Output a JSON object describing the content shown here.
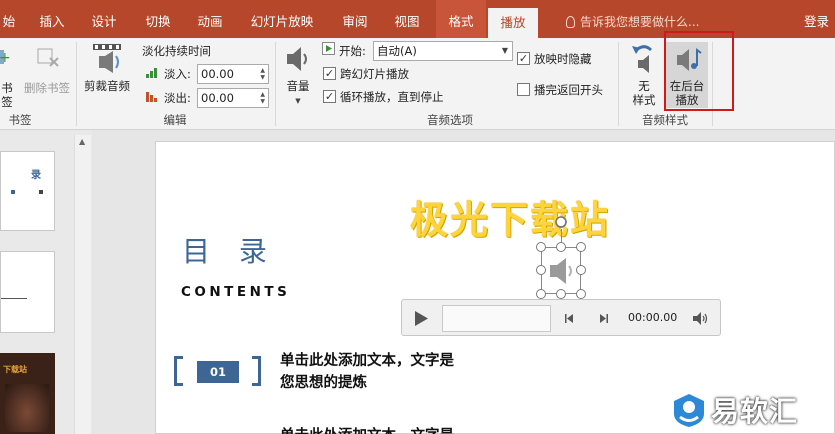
{
  "tabs": [
    {
      "label": "始"
    },
    {
      "label": "插入"
    },
    {
      "label": "设计"
    },
    {
      "label": "切换"
    },
    {
      "label": "动画"
    },
    {
      "label": "幻灯片放映"
    },
    {
      "label": "审阅"
    },
    {
      "label": "视图"
    },
    {
      "label": "格式"
    },
    {
      "label": "播放"
    }
  ],
  "tell_me": "告诉我您想要做什么...",
  "login": "登录",
  "ribbon": {
    "bookmarks": {
      "add_label": "书签",
      "remove_label": "删除书签",
      "group_label": "书签"
    },
    "editing": {
      "trim_label": "剪裁音频",
      "fade_title": "淡化持续时间",
      "fade_in_label": "淡入:",
      "fade_in_value": "00.00",
      "fade_out_label": "淡出:",
      "fade_out_value": "00.00",
      "group_label": "编辑"
    },
    "audio_options": {
      "volume_label": "音量",
      "start_label": "开始:",
      "start_value": "自动(A)",
      "cross_slides_label": "跨幻灯片播放",
      "cross_slides_checked": true,
      "loop_label": "循环播放，直到停止",
      "loop_checked": true,
      "hide_label": "放映时隐藏",
      "hide_checked": true,
      "rewind_label": "播完返回开头",
      "rewind_checked": false,
      "group_label": "音频选项"
    },
    "audio_styles": {
      "no_style_line1": "无",
      "no_style_line2": "样式",
      "bg_play_line1": "在后台",
      "bg_play_line2": "播放",
      "group_label": "音频样式"
    }
  },
  "slide": {
    "title": "目 录",
    "subtitle": "CONTENTS",
    "watermark": "极光下载站",
    "items": [
      {
        "number": "01",
        "line1": "单击此处添加文本，文字是",
        "line2": "您思想的提炼"
      }
    ],
    "partial_line": "单击此处添加文本，文字是",
    "player": {
      "time": "00:00.00",
      "progress": 0
    }
  },
  "thumbnails": {
    "slide1_text": "录",
    "slide3_text": "下载站"
  },
  "logo_text": "易软汇",
  "colors": {
    "accent": "#b7472a",
    "title_blue": "#3e6694",
    "highlight_box": "#d0191c",
    "watermark_yellow": "#ffd43b"
  }
}
